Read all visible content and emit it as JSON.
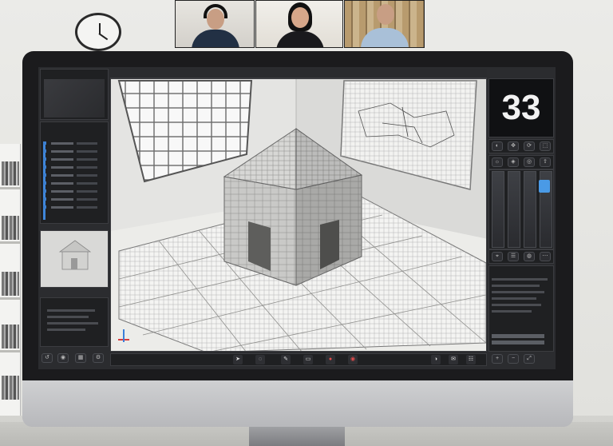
{
  "app": {
    "viewport_title": "",
    "frame_counter": "33",
    "accent_color": "#3f86da",
    "record_color": "#e14c4c"
  },
  "video_call": {
    "participants": [
      {
        "name": "",
        "headphones": true
      },
      {
        "name": ""
      },
      {
        "name": ""
      }
    ]
  },
  "left_panel": {
    "top_title": "",
    "properties_title": "",
    "layers_title": "",
    "icons": [
      "undo-icon",
      "camera-icon",
      "grid-icon",
      "settings-icon"
    ]
  },
  "right_panel": {
    "top_icons": [
      "view-icon",
      "move-icon",
      "rotate-icon",
      "scale-icon"
    ],
    "mid_icons": [
      "light-icon",
      "material-icon",
      "render-icon",
      "export-icon"
    ],
    "lower_icons": [
      "snap-icon",
      "layer-icon",
      "color-icon",
      "options-icon"
    ],
    "list_title": "",
    "bottom_icons": [
      "zoom-in-icon",
      "zoom-out-icon",
      "fit-icon"
    ]
  },
  "toolbar": {
    "icons": [
      "select-icon",
      "lasso-icon",
      "brush-icon",
      "eraser-icon",
      "record-icon",
      "fill-icon",
      "measure-icon",
      "comment-icon",
      "layers-icon"
    ]
  },
  "scene": {
    "object": "house-model",
    "floor": "grid-floor",
    "window": "window",
    "blueprint": "blueprint-poster"
  }
}
